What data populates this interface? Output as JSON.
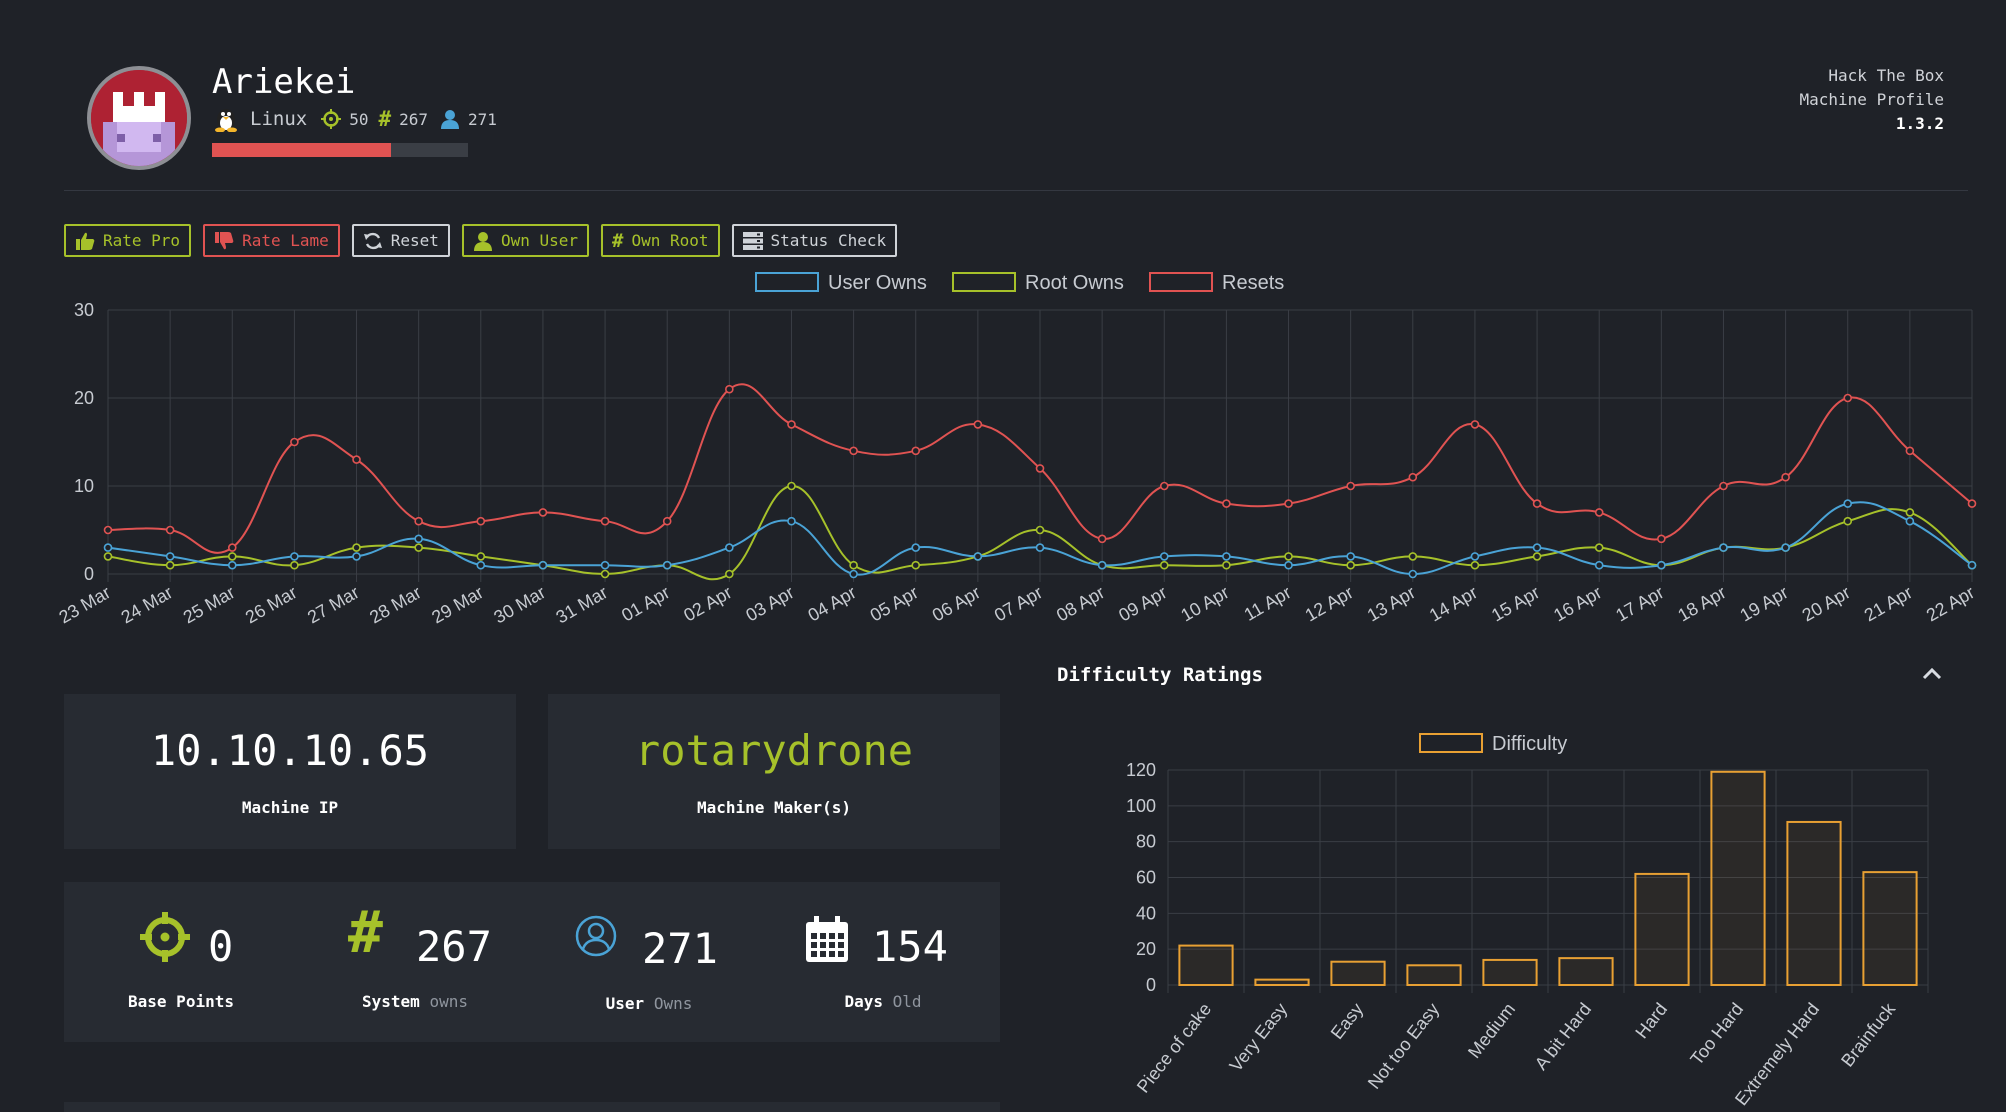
{
  "profile": {
    "name": "Ariekei",
    "os": "Linux",
    "points": "50",
    "system_owns": "267",
    "user_owns": "271",
    "health_fraction": 0.7
  },
  "corner": {
    "line1": "Hack The Box",
    "line2": "Machine Profile",
    "version": "1.3.2"
  },
  "buttons": {
    "rate_pro": "Rate Pro",
    "rate_lame": "Rate Lame",
    "reset": "Reset",
    "own_user": "Own User",
    "own_root": "Own Root",
    "status_check": "Status Check"
  },
  "colors": {
    "green": "#a6c12a",
    "red": "#e05352",
    "gray": "#cfd3d8",
    "blue": "#4aa3d6",
    "orange": "#e8a033"
  },
  "info": {
    "ip": "10.10.10.65",
    "ip_label": "Machine IP",
    "maker": "rotarydrone",
    "maker_label": "Machine Maker(s)"
  },
  "stats": {
    "base_points": "0",
    "base_points_label": "Base Points",
    "system": "267",
    "system_label": "System",
    "system_sub": "owns",
    "user": "271",
    "user_label": "User",
    "user_sub": "Owns",
    "days": "154",
    "days_label": "Days",
    "days_sub": "Old"
  },
  "difficulty_title": "Difficulty Ratings",
  "chart_data": [
    {
      "type": "line",
      "categories": [
        "23 Mar",
        "24 Mar",
        "25 Mar",
        "26 Mar",
        "27 Mar",
        "28 Mar",
        "29 Mar",
        "30 Mar",
        "31 Mar",
        "01 Apr",
        "02 Apr",
        "03 Apr",
        "04 Apr",
        "05 Apr",
        "06 Apr",
        "07 Apr",
        "08 Apr",
        "09 Apr",
        "10 Apr",
        "11 Apr",
        "12 Apr",
        "13 Apr",
        "14 Apr",
        "15 Apr",
        "16 Apr",
        "17 Apr",
        "18 Apr",
        "19 Apr",
        "20 Apr",
        "21 Apr",
        "22 Apr"
      ],
      "series": [
        {
          "name": "User Owns",
          "color": "#4aa3d6",
          "values": [
            3,
            2,
            1,
            2,
            2,
            4,
            1,
            1,
            1,
            1,
            3,
            6,
            0,
            3,
            2,
            3,
            1,
            2,
            2,
            1,
            2,
            0,
            2,
            3,
            1,
            1,
            3,
            3,
            8,
            6,
            1
          ]
        },
        {
          "name": "Root Owns",
          "color": "#a6c12a",
          "values": [
            2,
            1,
            2,
            1,
            3,
            3,
            2,
            1,
            0,
            1,
            0,
            10,
            1,
            1,
            2,
            5,
            1,
            1,
            1,
            2,
            1,
            2,
            1,
            2,
            3,
            1,
            3,
            3,
            6,
            7,
            1
          ]
        },
        {
          "name": "Resets",
          "color": "#e05352",
          "values": [
            5,
            5,
            3,
            15,
            13,
            6,
            6,
            7,
            6,
            6,
            21,
            17,
            14,
            14,
            17,
            12,
            4,
            10,
            8,
            8,
            10,
            11,
            17,
            8,
            7,
            4,
            10,
            11,
            20,
            14,
            8
          ]
        }
      ],
      "ylim": [
        0,
        30
      ],
      "yticks": [
        0,
        10,
        20,
        30
      ],
      "grid": true,
      "legend": "top-center"
    },
    {
      "type": "bar",
      "title": "Difficulty Ratings",
      "categories": [
        "Piece of cake",
        "Very Easy",
        "Easy",
        "Not too Easy",
        "Medium",
        "A bit Hard",
        "Hard",
        "Too Hard",
        "Extremely Hard",
        "Brainfuck"
      ],
      "series": [
        {
          "name": "Difficulty",
          "color": "#e8a033",
          "values": [
            22,
            3,
            13,
            11,
            14,
            15,
            62,
            119,
            91,
            63
          ]
        }
      ],
      "ylim": [
        0,
        120
      ],
      "yticks": [
        0,
        20,
        40,
        60,
        80,
        100,
        120
      ],
      "grid": true,
      "legend": "top-center"
    }
  ]
}
